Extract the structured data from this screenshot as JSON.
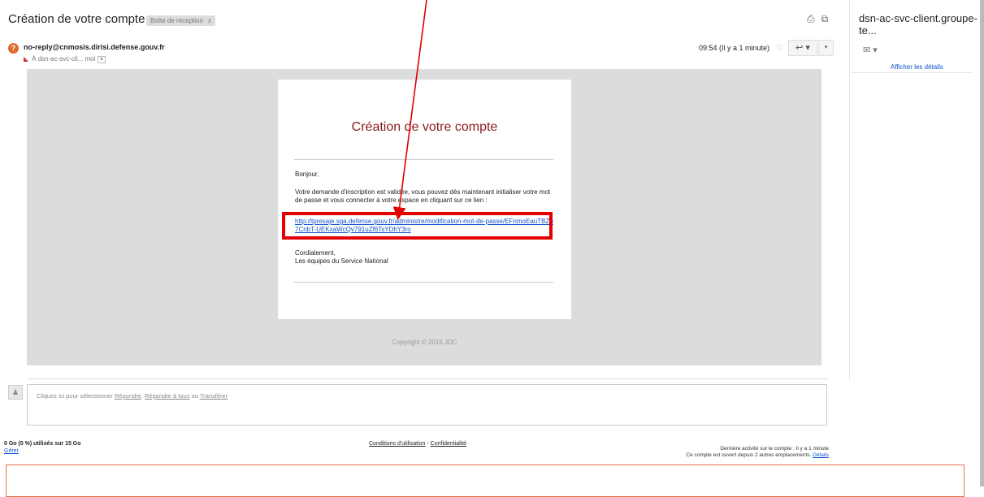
{
  "header": {
    "subject": "Création de votre compte",
    "label": "Boîte de réception",
    "label_close": "x",
    "print_icon": "⎙",
    "newwindow_icon": "⧉"
  },
  "sidebar": {
    "contact": "dsn-ac-svc-client.groupe-te...",
    "mail_icon": "✉ ▾",
    "details_link": "Afficher les détails"
  },
  "message": {
    "avatar": "?",
    "sender": "no-reply@cnmosis.dirisi.defense.gouv.fr",
    "recipient": "À dsn-ac-svc-cli... moi",
    "recipient_dropdown": "▾",
    "time": "09:54 (Il y a 1 minute)",
    "star": "☆",
    "reply_icon": "↩ ▾",
    "more_icon": "▾"
  },
  "email": {
    "title": "Création de votre compte",
    "greeting": "Bonjour,",
    "body": "Votre demande d'inscription est validée, vous pouvez dès maintenant initialiser votre mot de passe et vous connecter à votre espace en cliquant sur ce lien :",
    "link": "http://tpresaje.sga.defense.gouv.fr/administre/modification-mot-de-passe/EFnmoEauTBZb7CnbT-UEKxaWcQv791uZf6TsYDhY3ro",
    "signature_line1": "Cordialement,",
    "signature_line2": "Les équipes du Service National",
    "copyright": "Copyright © 2016 JDC"
  },
  "reply": {
    "hint_prefix": "Cliquez ici pour sélectionner ",
    "reply": "Répondre",
    "sep1": ", ",
    "reply_all": "Répondre à tous",
    "sep2": " ou ",
    "forward": "Transférer"
  },
  "footer": {
    "storage": "0 Go (0 %) utilisés sur 15 Go",
    "manage": "Gérer",
    "terms": "Conditions d'utilisation",
    "terms_sep": " - ",
    "privacy": "Confidentialité",
    "activity_line1": "Dernière activité sur le compte : Il y a 1 minute",
    "activity_line2_prefix": "Ce compte est ouvert depuis 2 autres emplacements. ",
    "activity_details": "Détails"
  },
  "colors": {
    "highlight": "#e30000",
    "link": "#1155cc",
    "title": "#8b1a1a"
  }
}
